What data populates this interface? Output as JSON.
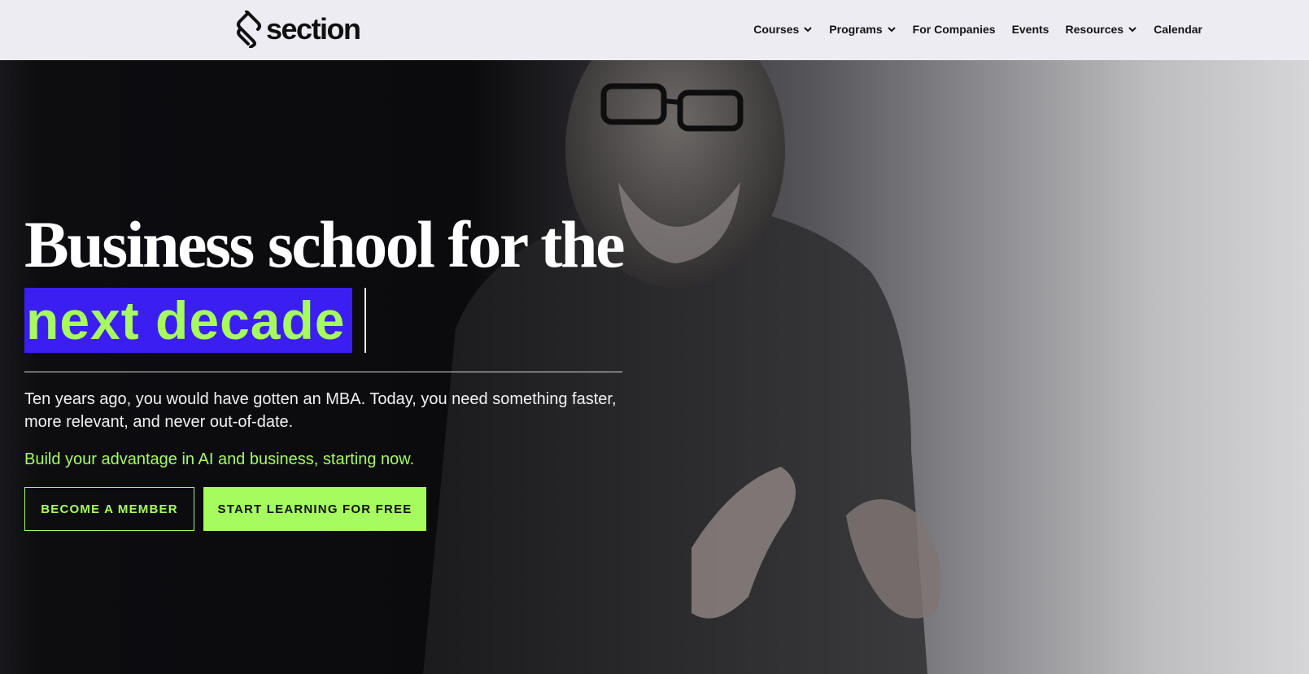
{
  "brand": {
    "name": "section",
    "logo_icon": "section-logo-icon"
  },
  "nav": {
    "items": [
      {
        "label": "Courses",
        "dropdown": true
      },
      {
        "label": "Programs",
        "dropdown": true
      },
      {
        "label": "For Companies",
        "dropdown": false
      },
      {
        "label": "Events",
        "dropdown": false
      },
      {
        "label": "Resources",
        "dropdown": true
      },
      {
        "label": "Calendar",
        "dropdown": false
      }
    ]
  },
  "hero": {
    "headline": "Business school for the",
    "headline_highlight": "next decade",
    "description": "Ten years ago, you would have gotten an MBA. Today, you need something faster, more relevant, and never out-of-date.",
    "tagline": "Build your advantage in AI and business, starting now.",
    "primary_button": "BECOME A MEMBER",
    "secondary_button": "START LEARNING FOR FREE"
  },
  "colors": {
    "accent_green": "#a6fb5f",
    "highlight_blue": "#3b1ff2",
    "topbar_bg": "#edecf3"
  }
}
